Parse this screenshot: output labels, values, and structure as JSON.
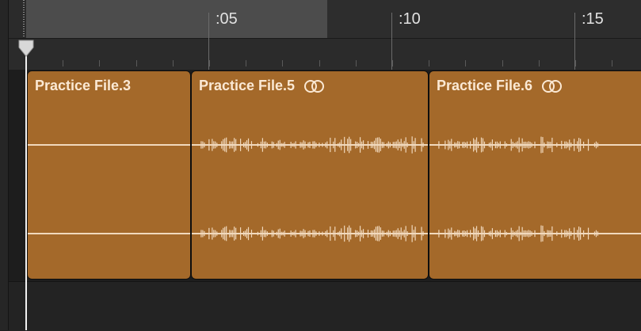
{
  "ruler": {
    "markers": [
      {
        "label": ":05"
      },
      {
        "label": ":10"
      },
      {
        "label": ":15"
      }
    ]
  },
  "regions": [
    {
      "name": "Practice File.3",
      "stereo": false,
      "has_audio": false,
      "icon": ""
    },
    {
      "name": "Practice File.5",
      "stereo": true,
      "has_audio": true,
      "icon": "stereo-link-icon"
    },
    {
      "name": "Practice File.6",
      "stereo": true,
      "has_audio": true,
      "icon": "stereo-link-icon"
    }
  ],
  "colors": {
    "region_fill": "#a4692a",
    "region_text": "#fbe9d4",
    "waveform": "#f1d9bd",
    "playhead": "#f2f2f2",
    "cycle_region": "#4c4c4c"
  }
}
